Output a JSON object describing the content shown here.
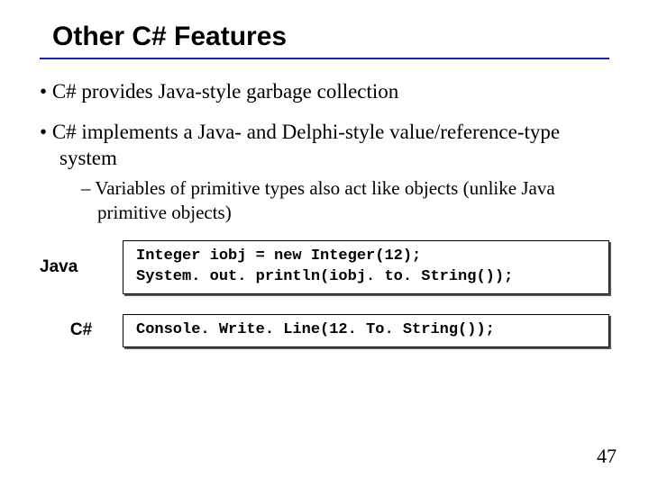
{
  "title": "Other C# Features",
  "bullets": {
    "b1": "C# provides Java-style garbage collection",
    "b2": "C# implements a Java- and Delphi-style value/reference-type system",
    "b2_sub1": "Variables of primitive types also act like objects (unlike Java primitive objects)"
  },
  "code": {
    "java_label": "Java",
    "java_code": "Integer iobj = new Integer(12);\nSystem. out. println(iobj. to. String());",
    "csharp_label": "C#",
    "csharp_code": "Console. Write. Line(12. To. String());"
  },
  "page_number": "47"
}
